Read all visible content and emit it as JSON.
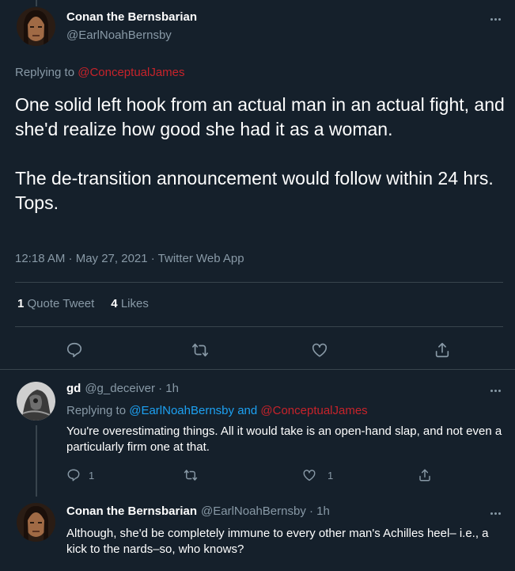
{
  "main_tweet": {
    "author_name": "Conan the Bernsbarian",
    "author_handle": "@EarlNoahBernsby",
    "replying_prefix": "Replying to",
    "replying_handle": "@ConceptualJames",
    "text_p1": "One solid left hook from an actual man in an actual fight, and she'd realize how good she had it as a woman.",
    "text_p2": "The de-transition announcement would follow within 24 hrs. Tops.",
    "timestamp": "12:18 AM · May 27, 2021 · Twitter Web App",
    "quote_count": "1",
    "quote_label": "Quote Tweet",
    "like_count": "4",
    "like_label": "Likes"
  },
  "reply_1": {
    "author_name": "gd",
    "author_meta": "@g_deceiver · 1h",
    "replying_prefix": "Replying to",
    "replying_handle_1": "@EarlNoahBernsby",
    "replying_and": "and",
    "replying_handle_2": "@ConceptualJames",
    "text": "You're overestimating things. All it would take is an open-hand slap, and not even a particularly firm one at that.",
    "reply_count": "1",
    "retweet_count": "",
    "like_count": "1"
  },
  "reply_2": {
    "author_name": "Conan the Bernsbarian",
    "author_meta": "@EarlNoahBernsby · 1h",
    "text": "Although, she'd be completely immune to every other man's Achilles heel– i.e., a kick to the nards–so, who knows?"
  },
  "colors": {
    "background": "#15202b",
    "muted": "#8899a6",
    "divider": "#38444d",
    "mention_red": "#c7232b",
    "mention_blue": "#1da1f2"
  },
  "icons": [
    "more-icon",
    "reply-icon",
    "retweet-icon",
    "like-icon",
    "share-icon"
  ]
}
